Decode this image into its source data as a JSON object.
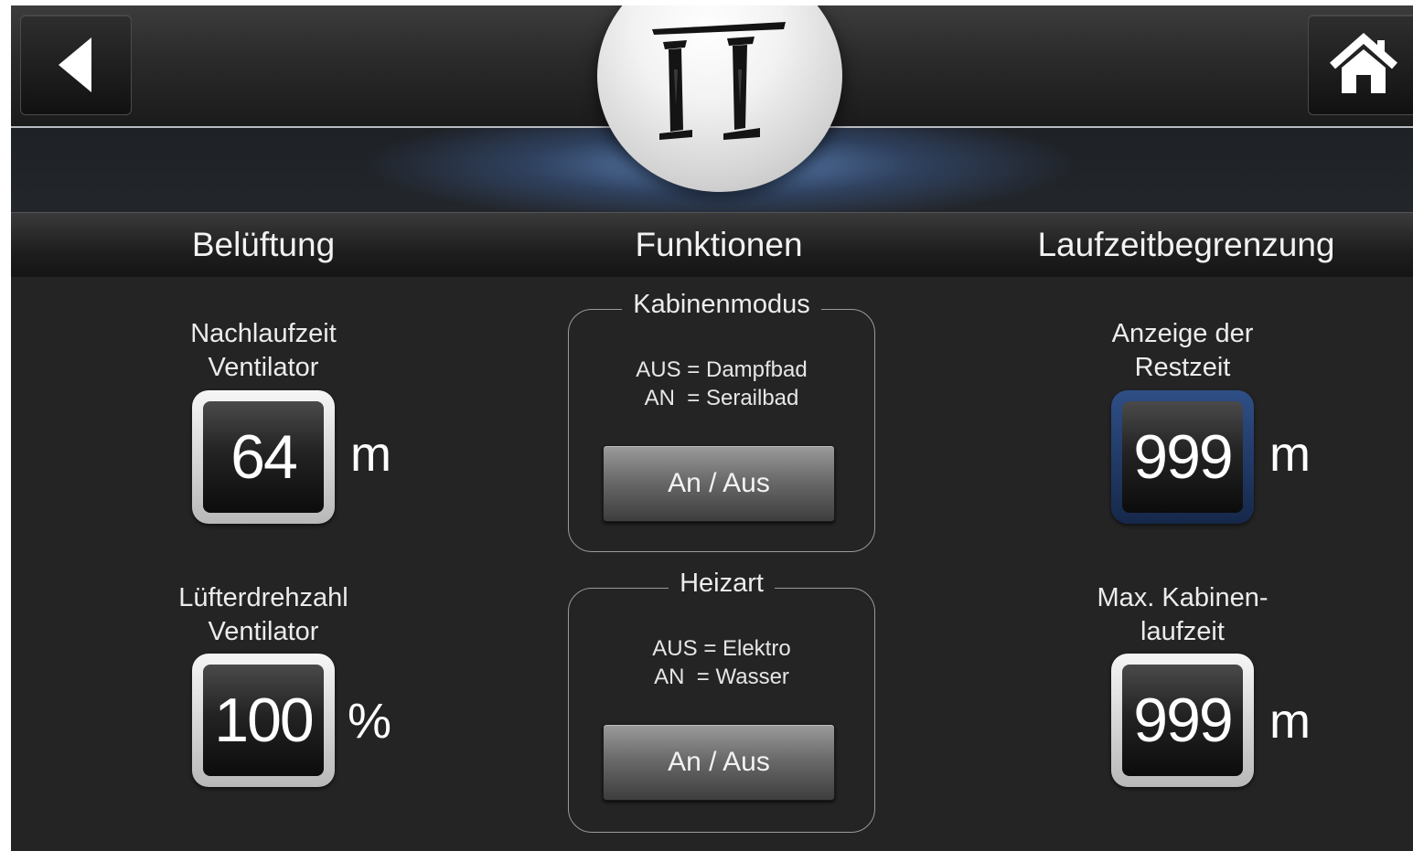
{
  "header": {
    "back_icon": "arrow-left-icon",
    "home_icon": "home-icon",
    "logo": "pillars-logo-icon"
  },
  "sections": {
    "left": "Belüftung",
    "center": "Funktionen",
    "right": "Laufzeitbegrenzung"
  },
  "ventilation": {
    "afterrun_label_1": "Nachlaufzeit",
    "afterrun_label_2": "Ventilator",
    "afterrun_value": "64",
    "afterrun_unit": "m",
    "speed_label_1": "Lüfterdrehzahl",
    "speed_label_2": "Ventilator",
    "speed_value": "100",
    "speed_unit": "%"
  },
  "functions": {
    "cabin_title": "Kabinenmodus",
    "cabin_line_1": "AUS = Dampfbad",
    "cabin_line_2": "AN  = Serailbad",
    "cabin_button": "An / Aus",
    "heat_title": "Heizart",
    "heat_line_1": "AUS = Elektro",
    "heat_line_2": "AN  = Wasser",
    "heat_button": "An / Aus"
  },
  "runtime": {
    "remaining_label_1": "Anzeige der",
    "remaining_label_2": "Restzeit",
    "remaining_value": "999",
    "remaining_unit": "m",
    "max_label_1": "Max. Kabinen-",
    "max_label_2": "laufzeit",
    "max_value": "999",
    "max_unit": "m"
  },
  "colors": {
    "background": "#242424",
    "accent_blue": "#2e4f86",
    "text": "#ececec"
  }
}
